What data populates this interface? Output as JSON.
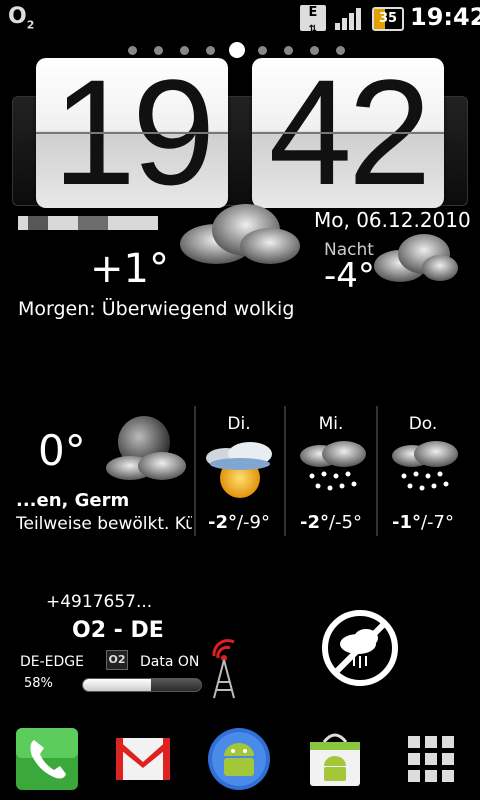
{
  "status_bar": {
    "carrier_logo": "O",
    "carrier_logo_sub": "2",
    "network_badge": "E",
    "battery_level": "35",
    "time": "19:42",
    "icons": [
      "o2-logo-icon",
      "edge-data-icon",
      "signal-bars-icon",
      "battery-icon"
    ]
  },
  "home": {
    "page_count": 9,
    "active_page": 4
  },
  "clock": {
    "hours": "19",
    "minutes": "42"
  },
  "weather": {
    "date": "Mo, 06.12.2010",
    "temp_now": "+1°",
    "night_label": "Nacht",
    "temp_night": "-4°",
    "tomorrow": "Morgen: Überwiegend wolkig",
    "today_temp": "0°",
    "location2": "...en, Germ",
    "condition": "Teilweise bewölkt. Kü",
    "forecast": [
      {
        "day": "Di.",
        "high": "-2°",
        "low": "/-9°",
        "icon": "cloud-sun-icon"
      },
      {
        "day": "Mi.",
        "high": "-2°",
        "low": "/-5°",
        "icon": "snow-cloud-icon"
      },
      {
        "day": "Do.",
        "high": "-1°",
        "low": "/-7°",
        "icon": "snow-cloud-icon"
      }
    ]
  },
  "network": {
    "phone_number": "+4917657...",
    "operator": "O2 - DE",
    "net_type": "DE-EDGE",
    "o2_badge": "O2",
    "data_status": "Data ON",
    "percent_label": "58%",
    "percent_value": 0.58
  },
  "dock": {
    "apps": [
      "phone-icon",
      "gmail-icon",
      "android-icon",
      "market-icon",
      "app-drawer-icon"
    ]
  },
  "colors": {
    "background": "#000000",
    "flip_card": "#f0f0f0",
    "battery": "#e0a000"
  }
}
